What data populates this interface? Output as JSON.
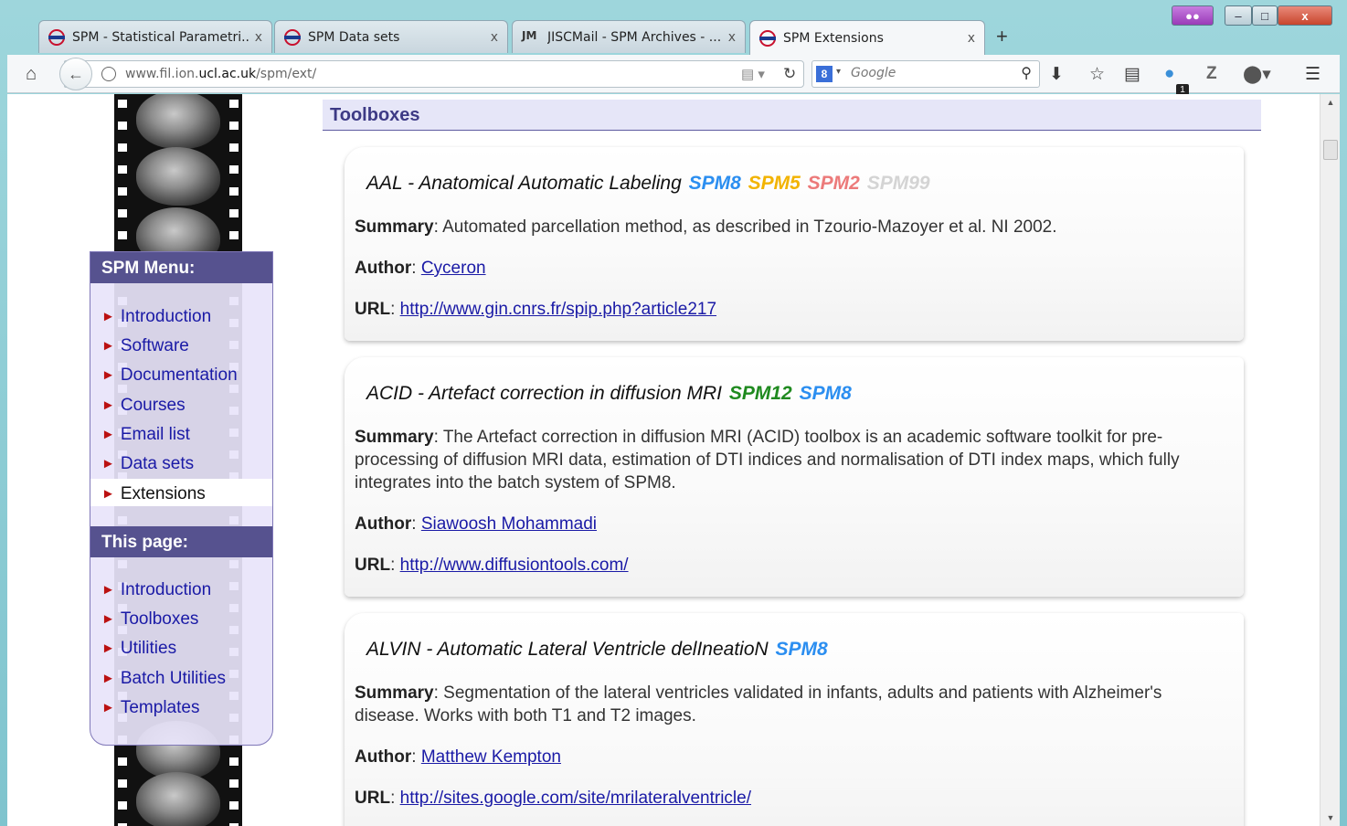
{
  "browser": {
    "tabs": [
      {
        "label": "SPM - Statistical Parametri...",
        "favicon": "ucl-roundel-icon"
      },
      {
        "label": "SPM Data sets",
        "favicon": "ucl-roundel-icon"
      },
      {
        "label": "JISCMail - SPM Archives - ...",
        "favicon": "jiscmail-icon",
        "favicon_text": "JM"
      },
      {
        "label": "SPM Extensions",
        "favicon": "ucl-roundel-icon",
        "active": true
      }
    ],
    "url_prefix": "www.fil.ion.",
    "url_domain": "ucl.ac.uk",
    "url_suffix": "/spm/ext/",
    "search_placeholder": "Google",
    "search_engine_letter": "8",
    "extension_badge": "1",
    "zotero_label": "Z",
    "close_glyph": "x",
    "min_glyph": "–",
    "max_glyph": "□"
  },
  "sidebar": {
    "menu_title": "SPM Menu:",
    "menu_items": [
      {
        "label": "Introduction"
      },
      {
        "label": "Software"
      },
      {
        "label": "Documentation"
      },
      {
        "label": "Courses"
      },
      {
        "label": "Email list"
      },
      {
        "label": "Data sets"
      },
      {
        "label": "Extensions",
        "current": true
      }
    ],
    "page_title": "This page:",
    "page_items": [
      {
        "label": "Introduction"
      },
      {
        "label": "Toolboxes"
      },
      {
        "label": "Utilities"
      },
      {
        "label": "Batch Utilities"
      },
      {
        "label": "Templates"
      }
    ]
  },
  "main": {
    "section_title": "Toolboxes",
    "colors": {
      "SPM12": "#1f8a1f",
      "SPM8": "#2b8ef0",
      "SPM5": "#f2b300",
      "SPM2": "#ec7a7a",
      "SPM99": "#d4d4d4"
    },
    "toolboxes": [
      {
        "name": "AAL - Anatomical Automatic Labeling",
        "versions": [
          "SPM8",
          "SPM5",
          "SPM2",
          "SPM99"
        ],
        "summary_label": "Summary",
        "summary": ": Automated parcellation method, as described in Tzourio-Mazoyer et al. NI 2002.",
        "author_label": "Author",
        "author": "Cyceron",
        "url_label": "URL",
        "url": "http://www.gin.cnrs.fr/spip.php?article217"
      },
      {
        "name": "ACID - Artefact correction in diffusion MRI",
        "versions": [
          "SPM12",
          "SPM8"
        ],
        "summary_label": "Summary",
        "summary": ": The Artefact correction in diffusion MRI (ACID) toolbox is an academic software toolkit for pre-processing of diffusion MRI data, estimation of DTI indices and normalisation of DTI index maps, which fully integrates into the batch system of SPM8.",
        "author_label": "Author",
        "author": "Siawoosh Mohammadi",
        "url_label": "URL",
        "url": "http://www.diffusiontools.com/"
      },
      {
        "name": "ALVIN - Automatic Lateral Ventricle delIneatioN",
        "versions": [
          "SPM8"
        ],
        "summary_label": "Summary",
        "summary": ": Segmentation of the lateral ventricles validated in infants, adults and patients with Alzheimer's disease. Works with both T1 and T2 images.",
        "author_label": "Author",
        "author": "Matthew Kempton",
        "url_label": "URL",
        "url": "http://sites.google.com/site/mrilateralventricle/"
      }
    ]
  }
}
